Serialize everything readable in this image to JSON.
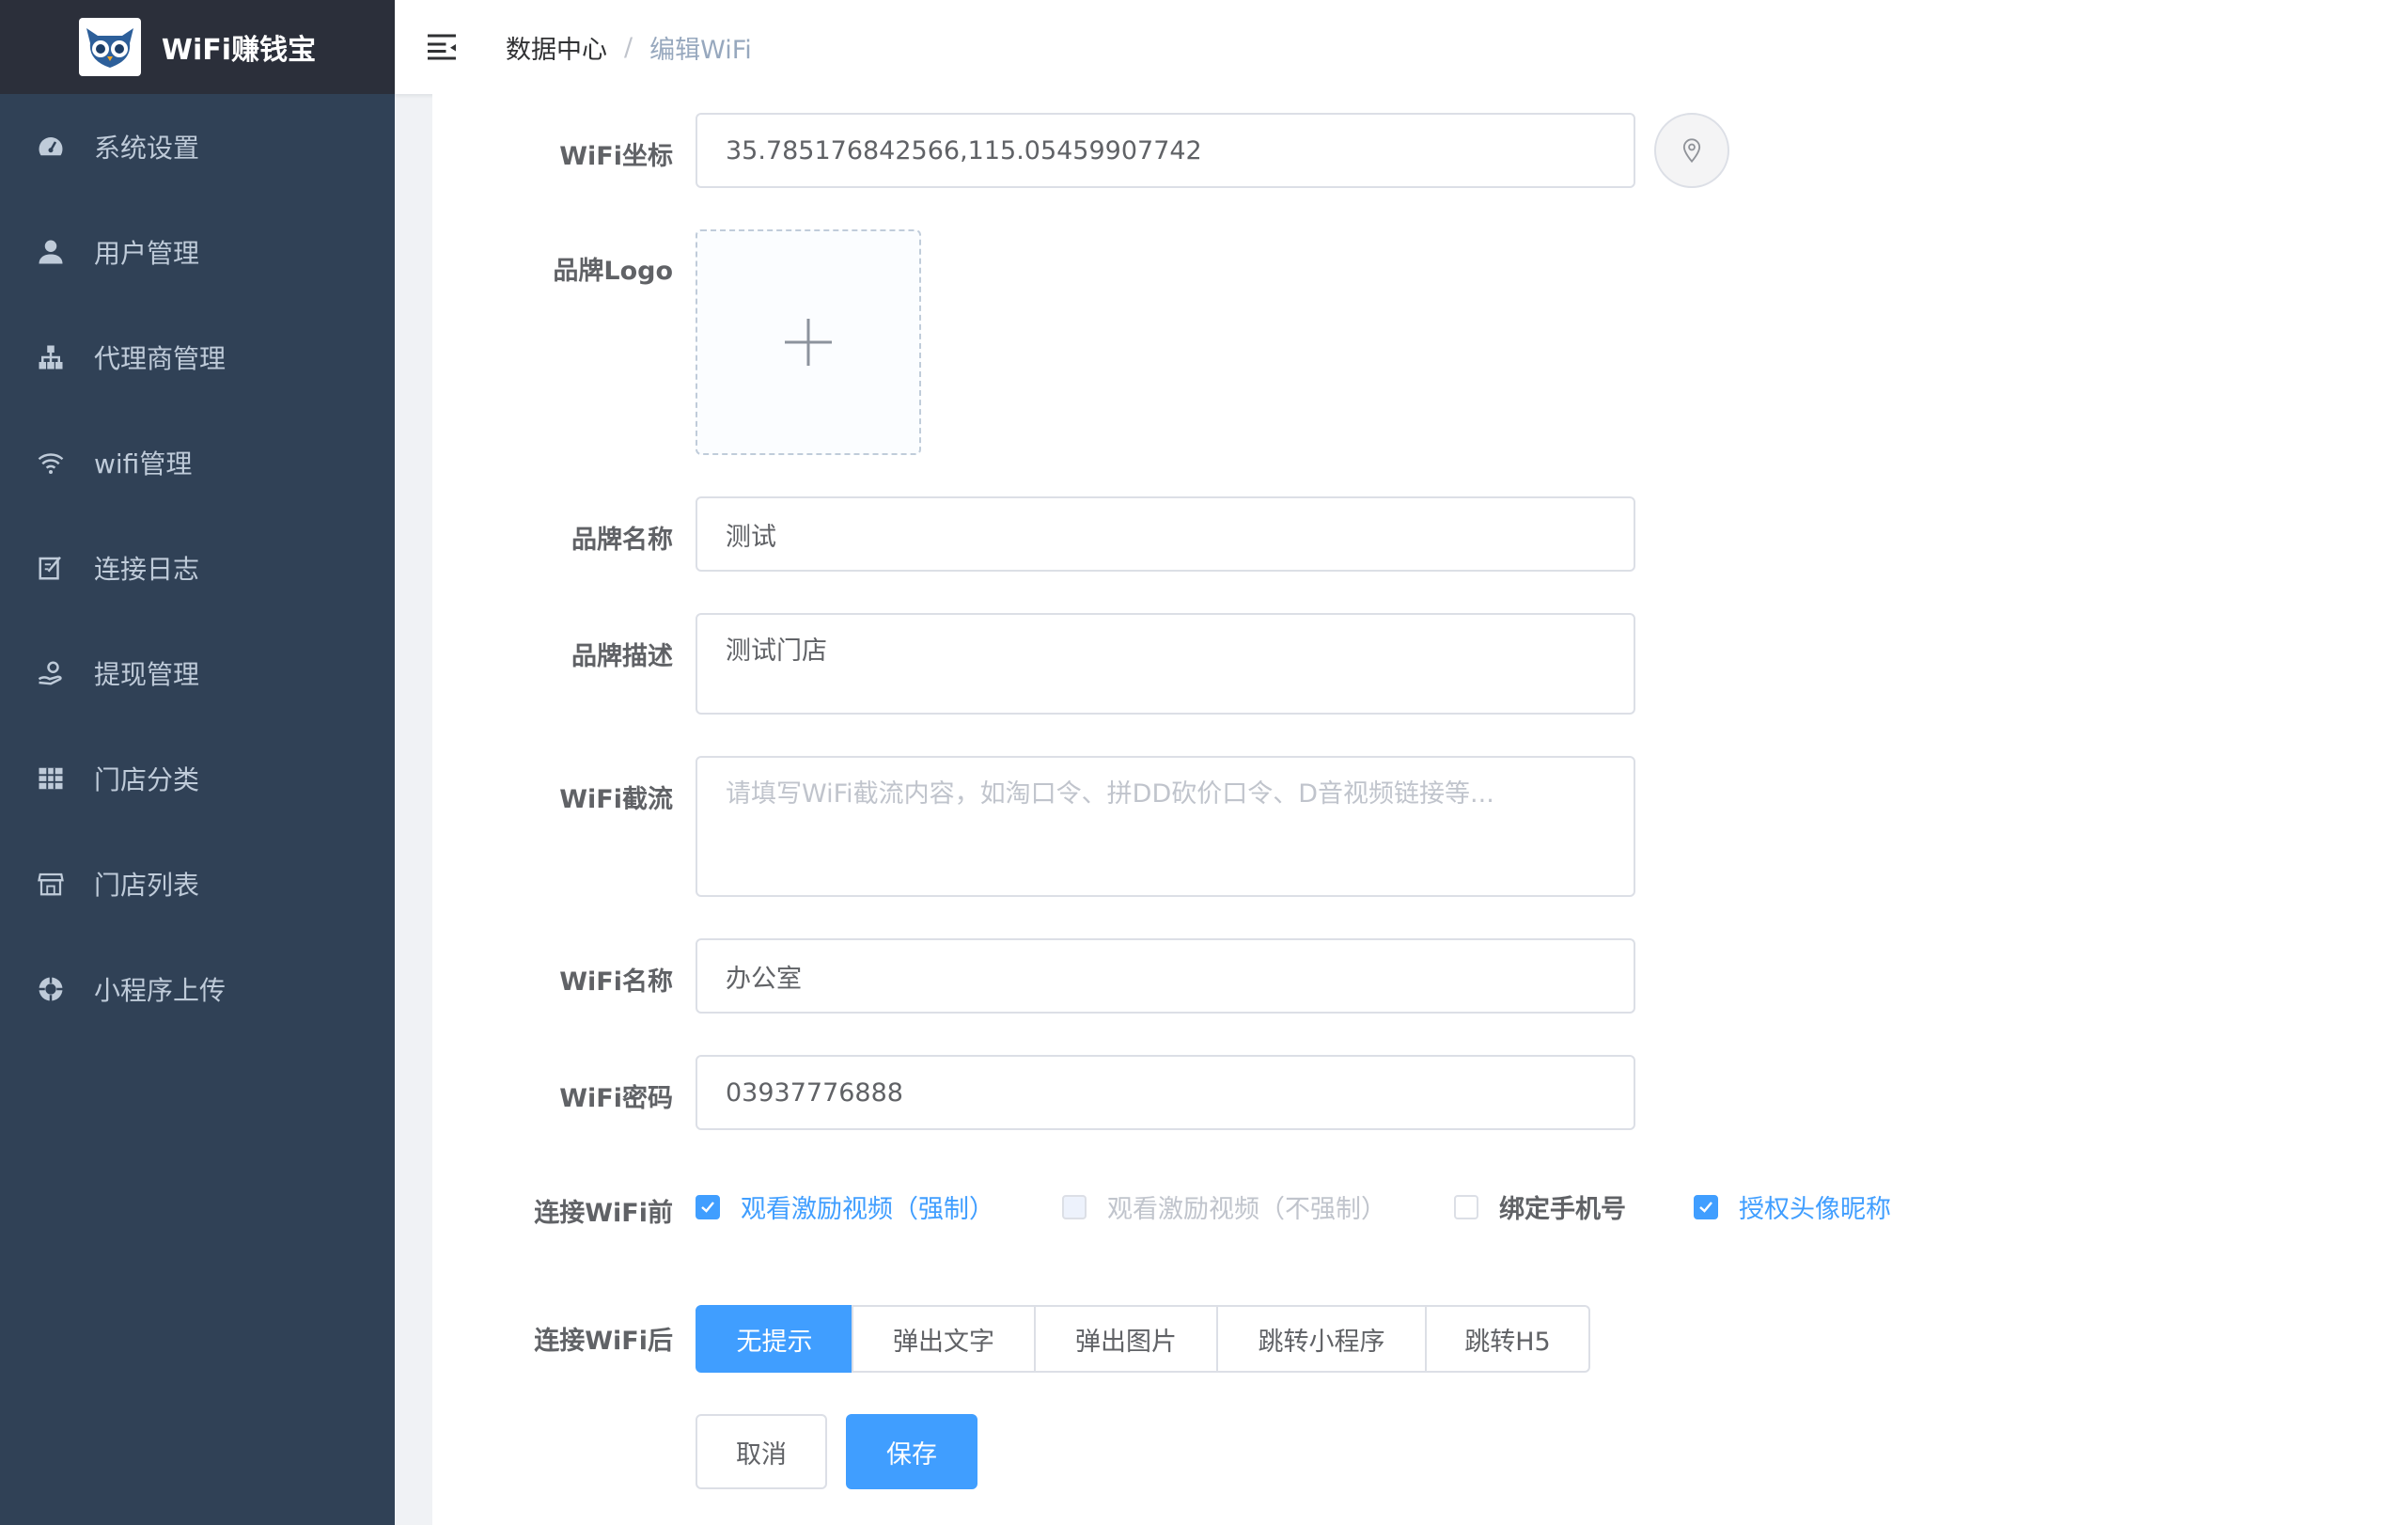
{
  "app": {
    "title": "WiFi赚钱宝"
  },
  "sidebar": {
    "items": [
      {
        "label": "系统设置",
        "icon": "dashboard-icon"
      },
      {
        "label": "用户管理",
        "icon": "user-icon"
      },
      {
        "label": "代理商管理",
        "icon": "tree-icon"
      },
      {
        "label": "wifi管理",
        "icon": "wifi-icon"
      },
      {
        "label": "连接日志",
        "icon": "edit-icon"
      },
      {
        "label": "提现管理",
        "icon": "hand-money-icon"
      },
      {
        "label": "门店分类",
        "icon": "table-icon"
      },
      {
        "label": "门店列表",
        "icon": "shop-icon"
      },
      {
        "label": "小程序上传",
        "icon": "lifebuoy-icon"
      }
    ]
  },
  "header": {
    "breadcrumb": [
      "数据中心",
      "编辑WiFi"
    ],
    "separator": "/"
  },
  "form": {
    "coords": {
      "label": "WiFi坐标",
      "value": "35.785176842566,115.05459907742"
    },
    "logo": {
      "label": "品牌Logo"
    },
    "brand_name": {
      "label": "品牌名称",
      "value": "测试"
    },
    "brand_desc": {
      "label": "品牌描述",
      "value": "测试门店"
    },
    "wifi_intercept": {
      "label": "WiFi截流",
      "placeholder": "请填写WiFi截流内容，如淘口令、拼DD砍价口令、D音视频链接等..."
    },
    "wifi_name": {
      "label": "WiFi名称",
      "value": "办公室"
    },
    "wifi_password": {
      "label": "WiFi密码",
      "value": "03937776888"
    },
    "before_connect": {
      "label": "连接WiFi前",
      "options": [
        {
          "label": "观看激励视频（强制）",
          "checked": true,
          "disabled": false
        },
        {
          "label": "观看激励视频（不强制）",
          "checked": false,
          "disabled": true
        },
        {
          "label": "绑定手机号",
          "checked": false,
          "disabled": false
        },
        {
          "label": "授权头像昵称",
          "checked": true,
          "disabled": false
        }
      ]
    },
    "after_connect": {
      "label": "连接WiFi后",
      "options": [
        "无提示",
        "弹出文字",
        "弹出图片",
        "跳转小程序",
        "跳转H5"
      ],
      "selected": "无提示"
    },
    "cancel_label": "取消",
    "save_label": "保存"
  },
  "colors": {
    "sidebar_bg": "#304156",
    "logo_bg": "#2b2f3a",
    "primary": "#409eff"
  }
}
